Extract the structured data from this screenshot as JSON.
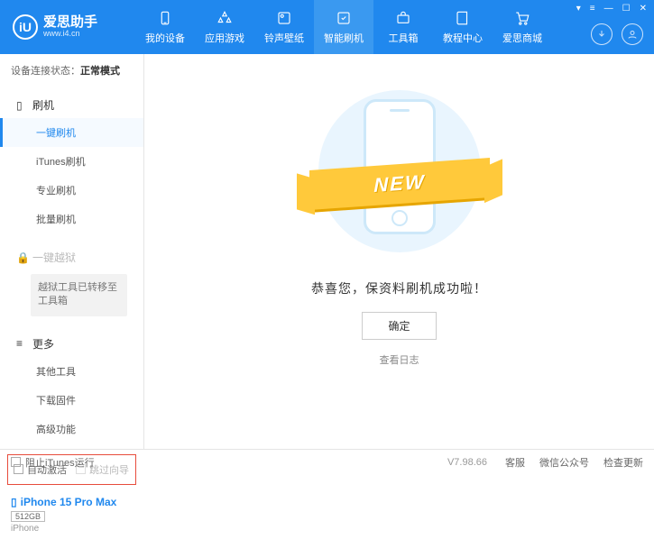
{
  "logo": {
    "badge": "iU",
    "title": "爱思助手",
    "subtitle": "www.i4.cn"
  },
  "topnav": {
    "items": [
      "我的设备",
      "应用游戏",
      "铃声壁纸",
      "智能刷机",
      "工具箱",
      "教程中心",
      "爱思商城"
    ],
    "activeIndex": 3
  },
  "connStatus": {
    "label": "设备连接状态：",
    "value": "正常模式"
  },
  "sidebar": {
    "flash": {
      "header": "刷机",
      "items": [
        "一键刷机",
        "iTunes刷机",
        "专业刷机",
        "批量刷机"
      ],
      "activeIndex": 0
    },
    "jailbreak": {
      "header": "一键越狱",
      "note": "越狱工具已转移至工具箱"
    },
    "more": {
      "header": "更多",
      "items": [
        "其他工具",
        "下载固件",
        "高级功能"
      ]
    }
  },
  "checkboxes": {
    "autoActivate": "自动激活",
    "skipGuide": "跳过向导"
  },
  "device": {
    "name": "iPhone 15 Pro Max",
    "storage": "512GB",
    "type": "iPhone"
  },
  "main": {
    "ribbon": "NEW",
    "successMsg": "恭喜您，保资料刷机成功啦！",
    "okBtn": "确定",
    "viewLog": "查看日志"
  },
  "footer": {
    "blockItunes": "阻止iTunes运行",
    "version": "V7.98.66",
    "links": [
      "客服",
      "微信公众号",
      "检查更新"
    ]
  }
}
